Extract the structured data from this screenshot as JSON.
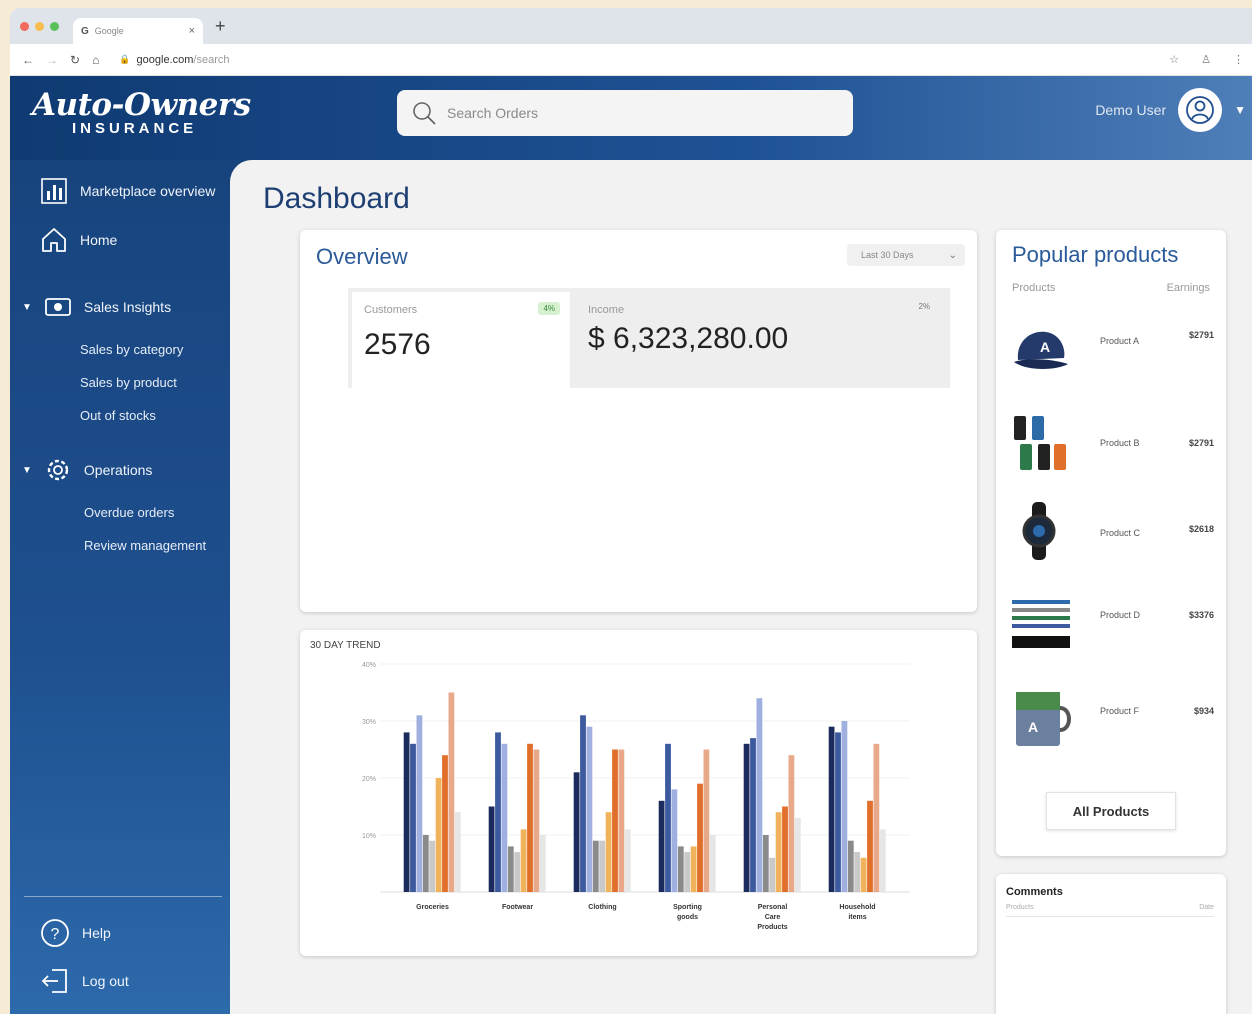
{
  "browser": {
    "tab_title": "Google",
    "tab_favicon": "G",
    "url_host": "google.com",
    "url_path": "/search"
  },
  "header": {
    "logo_brand": "Auto-Owners",
    "logo_sub": "INSURANCE",
    "search_placeholder": "Search Orders",
    "user_name": "Demo User"
  },
  "sidebar": {
    "items": [
      {
        "label": "Marketplace overview",
        "icon": "bar-chart-icon"
      },
      {
        "label": "Home",
        "icon": "home-icon"
      },
      {
        "label": "Sales Insights",
        "icon": "money-icon"
      },
      {
        "label": "Operations",
        "icon": "gear-icon"
      }
    ],
    "sales_sub": [
      "Sales by category",
      "Sales by product",
      "Out of stocks"
    ],
    "operations_sub": [
      "Overdue orders",
      "Review management"
    ],
    "help": "Help",
    "logout": "Log out"
  },
  "main": {
    "title": "Dashboard",
    "overview": {
      "title": "Overview",
      "range": "Last 30 Days",
      "customers_label": "Customers",
      "customers_badge": "4%",
      "customers_value": "2576",
      "income_label": "Income",
      "income_pct": "2%",
      "income_value": "$ 6,323,280.00"
    },
    "trend_title": "30 DAY TREND",
    "popular": {
      "title": "Popular products",
      "col_products": "Products",
      "col_earnings": "Earnings",
      "items": [
        {
          "name": "Product A",
          "earnings": "$2791",
          "icon": "cap-icon"
        },
        {
          "name": "Product B",
          "earnings": "$2791",
          "icon": "tumblers-icon"
        },
        {
          "name": "Product C",
          "earnings": "$2618",
          "icon": "watch-icon"
        },
        {
          "name": "Product D",
          "earnings": "$3376",
          "icon": "pens-icon"
        },
        {
          "name": "Product F",
          "earnings": "$934",
          "icon": "mug-icon"
        }
      ],
      "all_button": "All Products"
    },
    "comments": {
      "title": "Comments",
      "sub": "Products",
      "date": "Date"
    }
  },
  "colors": {
    "series": [
      "#1b2b5e",
      "#3d5a9e",
      "#9fb0e0",
      "#8a8a8a",
      "#c9c9c9",
      "#f0b35b",
      "#e06f2c",
      "#e8a98a",
      "#e6e6e6"
    ]
  },
  "chart_data": {
    "type": "bar",
    "title": "30 DAY TREND",
    "categories": [
      "Groceries",
      "Footwear",
      "Clothing",
      "Sporting goods",
      "Personal Care Products",
      "Household items"
    ],
    "ylim": [
      0,
      40
    ],
    "yticks": [
      "10%",
      "20%",
      "30%",
      "40%"
    ],
    "series": [
      {
        "values": [
          28,
          15,
          21,
          16,
          26,
          29
        ]
      },
      {
        "values": [
          26,
          28,
          31,
          26,
          27,
          28
        ]
      },
      {
        "values": [
          31,
          26,
          29,
          18,
          34,
          30
        ]
      },
      {
        "values": [
          10,
          8,
          9,
          8,
          10,
          9
        ]
      },
      {
        "values": [
          9,
          7,
          9,
          7,
          6,
          7
        ]
      },
      {
        "values": [
          20,
          11,
          14,
          8,
          14,
          6
        ]
      },
      {
        "values": [
          24,
          26,
          25,
          19,
          15,
          16
        ]
      },
      {
        "values": [
          35,
          25,
          25,
          25,
          24,
          26
        ]
      },
      {
        "values": [
          14,
          10,
          11,
          10,
          13,
          11
        ]
      }
    ]
  }
}
